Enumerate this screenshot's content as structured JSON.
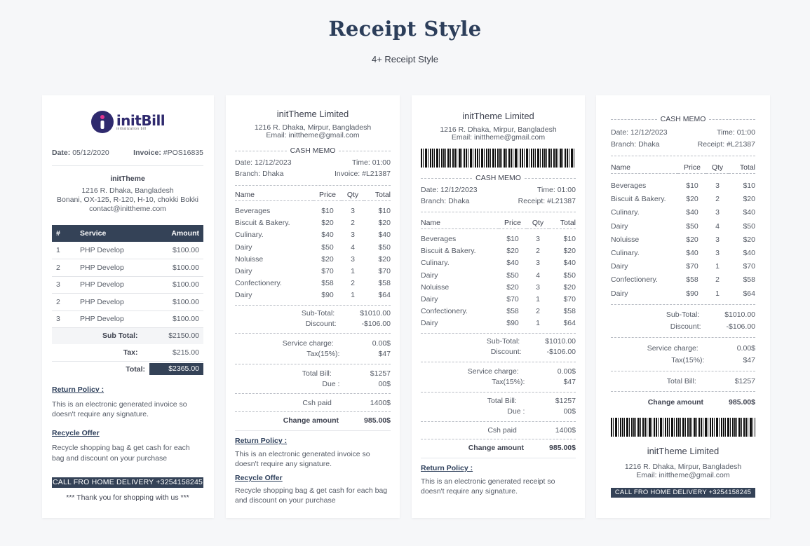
{
  "header": {
    "title": "Receipt Style",
    "subtitle": "4+ Receipt Style"
  },
  "colors": {
    "accent": "#344257",
    "background": "#f6f7f9"
  },
  "r1": {
    "logo_text": "initBill",
    "logo_tagline": "initialization bill",
    "date_label": "Date:",
    "date": "05/12/2020",
    "invoice_label": "Invoice:",
    "invoice": "#POS16835",
    "company": "initTheme",
    "address1": "1216 R. Dhaka, Bangladesh",
    "address2": "Bonani, OX-125, R-120, H-10, chokki Bokki",
    "email": "contact@inittheme.com",
    "cols": [
      "#",
      "Service",
      "Amount"
    ],
    "rows": [
      [
        "1",
        "PHP Develop",
        "$100.00"
      ],
      [
        "2",
        "PHP Develop",
        "$100.00"
      ],
      [
        "3",
        "PHP Develop",
        "$100.00"
      ],
      [
        "2",
        "PHP Develop",
        "$100.00"
      ],
      [
        "3",
        "PHP Develop",
        "$100.00"
      ]
    ],
    "subtotal_label": "Sub Total:",
    "subtotal": "$2150.00",
    "tax_label": "Tax:",
    "tax": "$215.00",
    "total_label": "Total:",
    "total": "$2365.00",
    "return_title": "Return Policy :",
    "return_text": "This is an electronic generated invoice so doesn't require any signature.",
    "recycle_title": "Recycle Offer",
    "recycle_text": "Recycle shopping bag & get cash for each bag and discount on your purchase",
    "call": "CALL FRO HOME DELIVERY +3254158245",
    "thanks": "*** Thank you for shopping with us ***"
  },
  "r2": {
    "company": "initTheme Limited",
    "address": "1216 R. Dhaka, Mirpur, Bangladesh",
    "email": "Email: inittheme@gmail.com",
    "memo": "CASH MEMO",
    "date": "Date: 12/12/2023",
    "time": "Time: 01:00",
    "branch": "Branch: Dhaka",
    "invoice": "Invoice: #L21387",
    "cols": [
      "Name",
      "Price",
      "Qty",
      "Total"
    ],
    "rows": [
      [
        "Beverages",
        "$10",
        "3",
        "$10"
      ],
      [
        "Biscuit & Bakery.",
        "$20",
        "2",
        "$20"
      ],
      [
        "Culinary.",
        "$40",
        "3",
        "$40"
      ],
      [
        "Dairy",
        "$50",
        "4",
        "$50"
      ],
      [
        "Noluisse",
        "$20",
        "3",
        "$20"
      ],
      [
        "Dairy",
        "$70",
        "1",
        "$70"
      ],
      [
        "Confectionery.",
        "$58",
        "2",
        "$58"
      ],
      [
        "Dairy",
        "$90",
        "1",
        "$64"
      ]
    ],
    "subtotal_label": "Sub-Total:",
    "subtotal": "$1010.00",
    "discount_label": "Discount:",
    "discount": "-$106.00",
    "service_label": "Service charge:",
    "service": "0.00$",
    "tax_label": "Tax(15%):",
    "tax": "$47",
    "totalbill_label": "Total Bill:",
    "totalbill": "$1257",
    "due_label": "Due :",
    "due": "00$",
    "paid_label": "Csh paid",
    "paid": "1400$",
    "change_label": "Change amount",
    "change": "985.00$",
    "return_title": "Return Policy :",
    "return_text": "This is an electronic generated invoice so doesn't require any signature.",
    "recycle_title": "Recycle Offer",
    "recycle_text": "Recycle shopping bag & get cash for each bag and discount on your purchase"
  },
  "r3": {
    "company": "initTheme Limited",
    "address": "1216 R. Dhaka, Mirpur, Bangladesh",
    "email": "Email: inittheme@gmail.com",
    "memo": "CASH MEMO",
    "date": "Date: 12/12/2023",
    "time": "Time: 01:00",
    "branch": "Branch: Dhaka",
    "receipt": "Receipt: #L21387",
    "cols": [
      "Name",
      "Price",
      "Qty",
      "Total"
    ],
    "rows": [
      [
        "Beverages",
        "$10",
        "3",
        "$10"
      ],
      [
        "Biscuit & Bakery.",
        "$20",
        "2",
        "$20"
      ],
      [
        "Culinary.",
        "$40",
        "3",
        "$40"
      ],
      [
        "Dairy",
        "$50",
        "4",
        "$50"
      ],
      [
        "Noluisse",
        "$20",
        "3",
        "$20"
      ],
      [
        "Dairy",
        "$70",
        "1",
        "$70"
      ],
      [
        "Confectionery.",
        "$58",
        "2",
        "$58"
      ],
      [
        "Dairy",
        "$90",
        "1",
        "$64"
      ]
    ],
    "subtotal_label": "Sub-Total:",
    "subtotal": "$1010.00",
    "discount_label": "Discount:",
    "discount": "-$106.00",
    "service_label": "Service charge:",
    "service": "0.00$",
    "tax_label": "Tax(15%):",
    "tax": "$47",
    "totalbill_label": "Total Bill:",
    "totalbill": "$1257",
    "due_label": "Due :",
    "due": "00$",
    "paid_label": "Csh paid",
    "paid": "1400$",
    "change_label": "Change amount",
    "change": "985.00$",
    "return_title": "Return Policy :",
    "return_text": "This is an electronic generated receipt so doesn't require any signature."
  },
  "r4": {
    "memo": "CASH MEMO",
    "date": "Date: 12/12/2023",
    "time": "Time: 01:00",
    "branch": "Branch: Dhaka",
    "receipt": "Receipt: #L21387",
    "cols": [
      "Name",
      "Price",
      "Qty",
      "Total"
    ],
    "rows": [
      [
        "Beverages",
        "$10",
        "3",
        "$10"
      ],
      [
        "Biscuit & Bakery.",
        "$20",
        "2",
        "$20"
      ],
      [
        "Culinary.",
        "$40",
        "3",
        "$40"
      ],
      [
        "Dairy",
        "$50",
        "4",
        "$50"
      ],
      [
        "Noluisse",
        "$20",
        "3",
        "$20"
      ],
      [
        "Culinary.",
        "$40",
        "3",
        "$40"
      ],
      [
        "Dairy",
        "$70",
        "1",
        "$70"
      ],
      [
        "Confectionery.",
        "$58",
        "2",
        "$58"
      ],
      [
        "Dairy",
        "$90",
        "1",
        "$64"
      ]
    ],
    "subtotal_label": "Sub-Total:",
    "subtotal": "$1010.00",
    "discount_label": "Discount:",
    "discount": "-$106.00",
    "service_label": "Service charge:",
    "service": "0.00$",
    "tax_label": "Tax(15%):",
    "tax": "$47",
    "totalbill_label": "Total Bill:",
    "totalbill": "$1257",
    "change_label": "Change amount",
    "change": "985.00$",
    "company": "initTheme Limited",
    "address": "1216 R. Dhaka, Mirpur, Bangladesh",
    "email": "Email: inittheme@gmail.com",
    "call": "CALL FRO HOME DELIVERY +3254158245"
  }
}
